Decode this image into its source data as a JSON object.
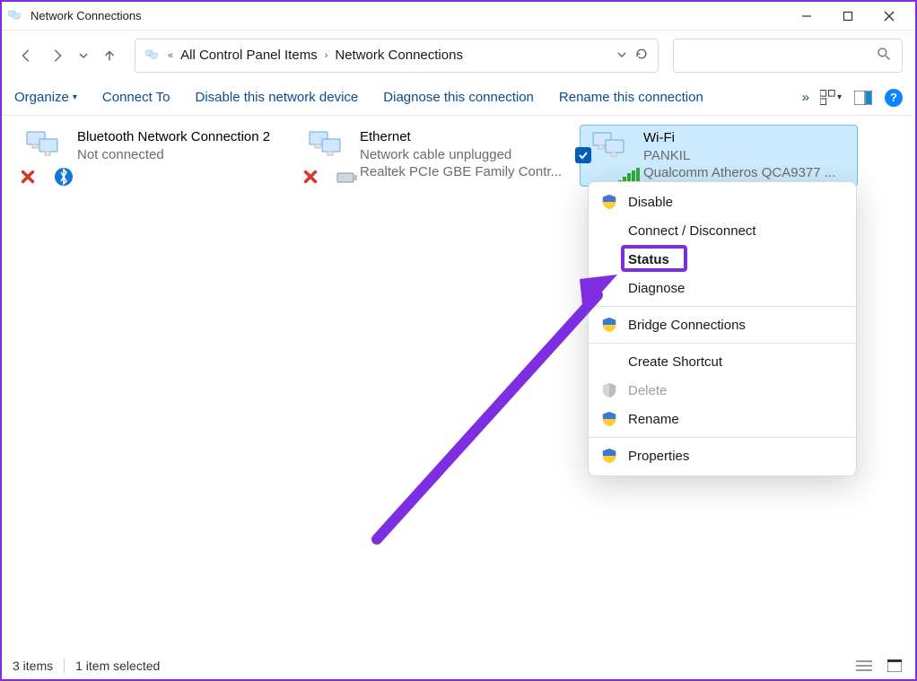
{
  "window": {
    "title": "Network Connections"
  },
  "breadcrumb": {
    "prefix": "«",
    "item1": "All Control Panel Items",
    "item2": "Network Connections"
  },
  "search": {
    "placeholder": ""
  },
  "toolbar": {
    "organize": "Organize",
    "connect_to": "Connect To",
    "disable": "Disable this network device",
    "diagnose": "Diagnose this connection",
    "rename": "Rename this connection",
    "more": "»"
  },
  "connections": [
    {
      "name": "Bluetooth Network Connection 2",
      "line2": "Not connected",
      "line3": "",
      "status_icon": "x-red",
      "overlay_icon": "bluetooth"
    },
    {
      "name": "Ethernet",
      "line2": "Network cable unplugged",
      "line3": "Realtek PCIe GBE Family Contr...",
      "status_icon": "x-red",
      "overlay_icon": "rj45"
    },
    {
      "name": "Wi-Fi",
      "line2": "PANKIL",
      "line3": "Qualcomm Atheros QCA9377 ...",
      "status_icon": "",
      "overlay_icon": "wifi-bars",
      "selected": true
    }
  ],
  "context_menu": {
    "items": {
      "disable": "Disable",
      "connect": "Connect / Disconnect",
      "status": "Status",
      "diagnose": "Diagnose",
      "bridge": "Bridge Connections",
      "shortcut": "Create Shortcut",
      "delete": "Delete",
      "rename": "Rename",
      "properties": "Properties"
    },
    "highlighted": "Status"
  },
  "statusbar": {
    "count": "3 items",
    "selection": "1 item selected"
  },
  "colors": {
    "annotation": "#7c2ee0",
    "link": "#0a4e8f",
    "selected_bg": "#ccebff"
  }
}
